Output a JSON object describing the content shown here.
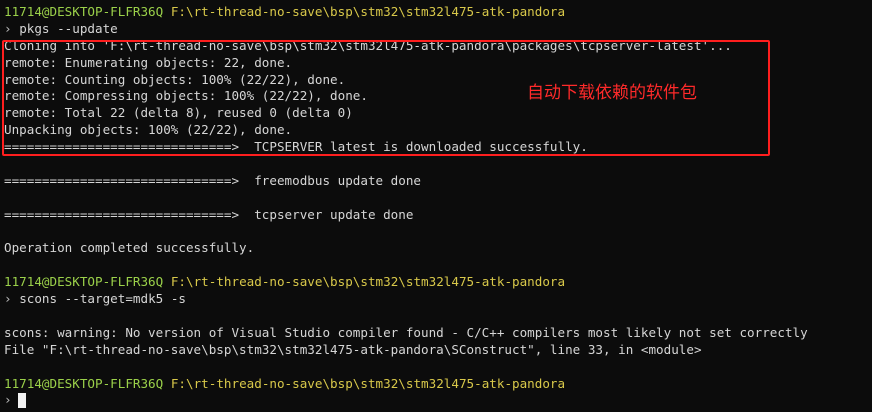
{
  "prompt1": {
    "user": "11714@DESKTOP-FLFR36Q",
    "path": "F:\\rt-thread-no-save\\bsp\\stm32\\stm32l475-atk-pandora"
  },
  "cmd1": "pkgs --update",
  "block": [
    "Cloning into 'F:\\rt-thread-no-save\\bsp\\stm32\\stm32l475-atk-pandora\\packages\\tcpserver-latest'...",
    "remote: Enumerating objects: 22, done.",
    "remote: Counting objects: 100% (22/22), done.",
    "remote: Compressing objects: 100% (22/22), done.",
    "remote: Total 22 (delta 8), reused 0 (delta 0)",
    "Unpacking objects: 100% (22/22), done.",
    "==============================>  TCPSERVER latest is downloaded successfully."
  ],
  "annotation": "自动下载依赖的软件包",
  "freemodbus_line": "==============================>  freemodbus update done",
  "tcpserver_line": "==============================>  tcpserver update done",
  "operation_line": "Operation completed successfully.",
  "prompt2": {
    "user": "11714@DESKTOP-FLFR36Q",
    "path": "F:\\rt-thread-no-save\\bsp\\stm32\\stm32l475-atk-pandora"
  },
  "cmd2": "scons --target=mdk5 -s",
  "warning1": "scons: warning: No version of Visual Studio compiler found - C/C++ compilers most likely not set correctly",
  "warning2": "File \"F:\\rt-thread-no-save\\bsp\\stm32\\stm32l475-atk-pandora\\SConstruct\", line 33, in <module>",
  "prompt3": {
    "user": "11714@DESKTOP-FLFR36Q",
    "path": "F:\\rt-thread-no-save\\bsp\\stm32\\stm32l475-atk-pandora"
  },
  "prompt_char": "›"
}
